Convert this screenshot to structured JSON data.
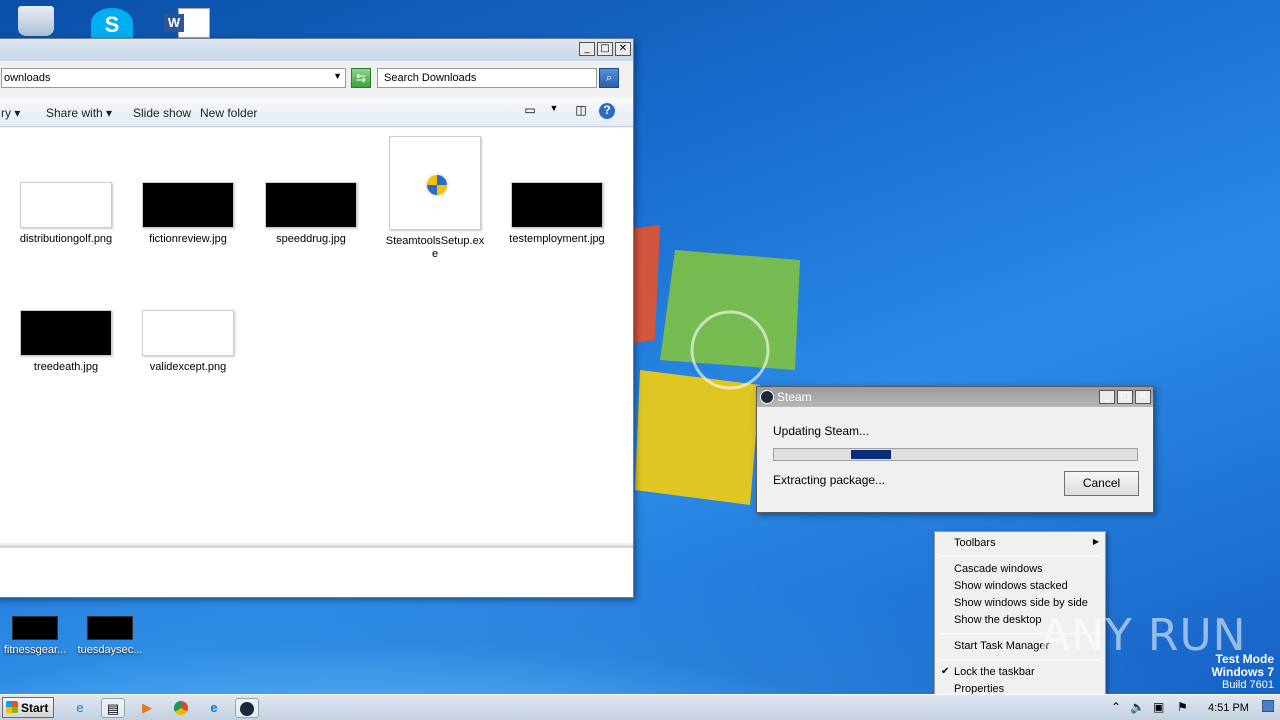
{
  "desktop": {
    "top_icons": [
      "recycle-bin-icon",
      "skype-icon",
      "word-doc-icon"
    ],
    "icons": [
      {
        "label": "fitnessgear...",
        "color": "#000000"
      },
      {
        "label": "tuesdaysec...",
        "color": "#000000"
      }
    ],
    "watermark": {
      "line1": "Test Mode",
      "line2": "Windows 7",
      "line3": "Build 7601"
    },
    "brand": "ANY RUN"
  },
  "explorer": {
    "address": "ownloads",
    "search_placeholder": "Search Downloads",
    "toolbar": {
      "library_label": "ry",
      "share_label": "Share with",
      "slideshow_label": "Slide show",
      "newfolder_label": "New folder"
    },
    "files": [
      {
        "name": "distributiongolf.png",
        "thumb": "#ffffff"
      },
      {
        "name": "fictionreview.jpg",
        "thumb": "#000000"
      },
      {
        "name": "speeddrug.jpg",
        "thumb": "#000000"
      },
      {
        "name": "SteamtoolsSetup.exe",
        "thumb": "#ffffff"
      },
      {
        "name": "testemployment.jpg",
        "thumb": "#000000"
      },
      {
        "name": "treedeath.jpg",
        "thumb": "#000000"
      },
      {
        "name": "validexcept.png",
        "thumb": "#ffffff"
      }
    ]
  },
  "steam": {
    "title": "Steam",
    "status": "Updating Steam...",
    "detail": "Extracting package...",
    "cancel_label": "Cancel",
    "progress": 0.2
  },
  "context_menu": {
    "items": [
      {
        "label": "Toolbars",
        "submenu": true
      },
      {
        "label": "Cascade windows"
      },
      {
        "label": "Show windows stacked"
      },
      {
        "label": "Show windows side by side"
      },
      {
        "label": "Show the desktop"
      },
      {
        "label": "Start Task Manager"
      },
      {
        "label": "Lock the taskbar",
        "checked": true
      },
      {
        "label": "Properties"
      }
    ]
  },
  "taskbar": {
    "start_label": "Start",
    "apps": [
      "ie-icon",
      "explorer-icon",
      "media-player-icon",
      "chrome-icon",
      "edge-icon",
      "steam-icon"
    ],
    "clock": "4:51 PM"
  }
}
